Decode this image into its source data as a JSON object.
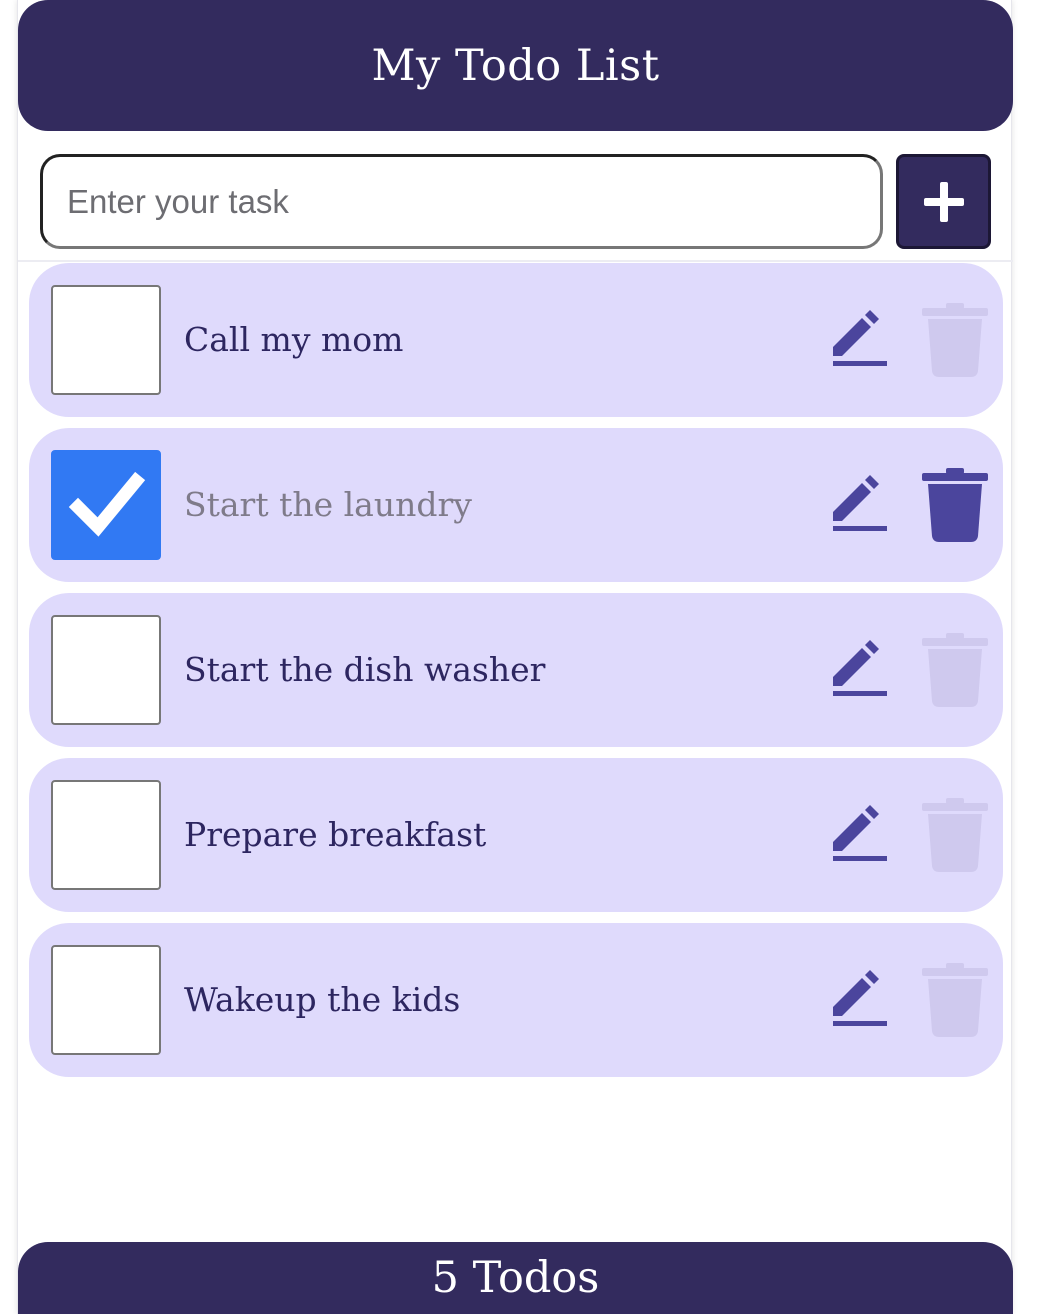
{
  "header": {
    "title": "My Todo List"
  },
  "input": {
    "placeholder": "Enter your task",
    "value": ""
  },
  "add_button": {
    "icon": "plus-icon"
  },
  "colors": {
    "brand": "#332b5e",
    "item_background": "#dfdafc",
    "checkbox_checked": "#3179f3",
    "icon_active": "#4b459d",
    "icon_disabled": "#cfc9ee"
  },
  "todos": [
    {
      "text": "Call my mom",
      "completed": false,
      "delete_enabled": false
    },
    {
      "text": "Start the laundry",
      "completed": true,
      "delete_enabled": true
    },
    {
      "text": "Start the dish washer",
      "completed": false,
      "delete_enabled": false
    },
    {
      "text": "Prepare breakfast",
      "completed": false,
      "delete_enabled": false
    },
    {
      "text": "Wakeup the kids",
      "completed": false,
      "delete_enabled": false
    }
  ],
  "footer": {
    "count_label": "5 Todos"
  }
}
